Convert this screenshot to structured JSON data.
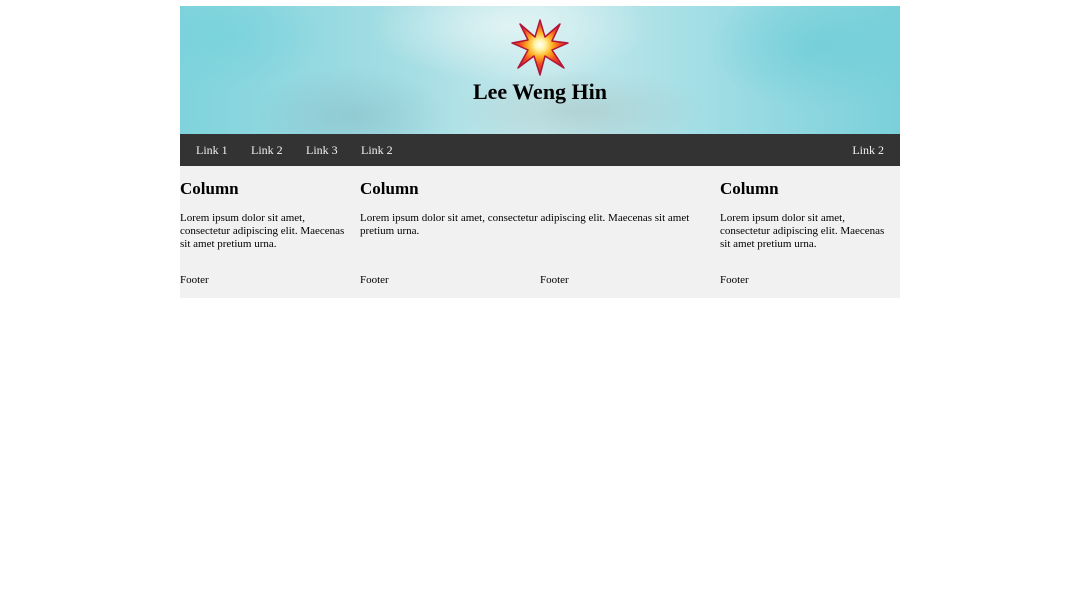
{
  "header": {
    "title": "Lee Weng Hin",
    "logo_icon": "explosion-star-icon"
  },
  "nav": {
    "links_left": [
      "Link 1",
      "Link 2",
      "Link 3",
      "Link 2"
    ],
    "link_right": "Link 2"
  },
  "columns": [
    {
      "heading": "Column",
      "text": "Lorem ipsum dolor sit amet, consectetur adipiscing elit. Maecenas sit amet pretium urna."
    },
    {
      "heading": "Column",
      "text": "Lorem ipsum dolor sit amet, consectetur adipiscing elit. Maecenas sit amet pretium urna."
    },
    {
      "heading": "Column",
      "text": "Lorem ipsum dolor sit amet, consectetur adipiscing elit. Maecenas sit amet pretium urna."
    }
  ],
  "footer": [
    "Footer",
    "Footer",
    "Footer",
    "Footer"
  ],
  "colors": {
    "navbar_bg": "#333333",
    "nav_text": "#f2f2f2",
    "content_bg": "#f1f1f1",
    "header_sky": "#a9dfe5"
  }
}
